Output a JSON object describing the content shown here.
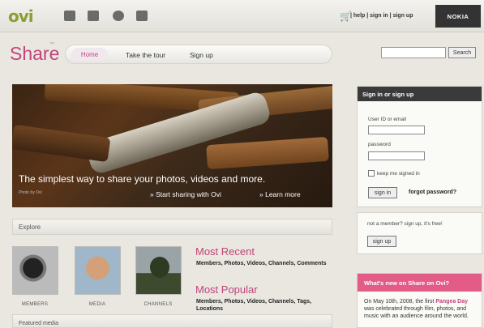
{
  "topbar": {
    "logo": "ovi",
    "icons": [
      "camera-icon",
      "music-icon",
      "globe-icon",
      "grid-icon"
    ],
    "links": [
      "help",
      "sign in",
      "sign up"
    ],
    "brand": "NOKIA"
  },
  "header": {
    "title": "Share",
    "nav": [
      "Home",
      "Take the tour",
      "Sign up"
    ],
    "search_placeholder": "",
    "search_label": "Search"
  },
  "hero": {
    "tagline": "The simplest way to share your photos, videos and more.",
    "credit": "Photo by Ovi",
    "cta_primary": "Start sharing with Ovi",
    "cta_secondary": "Learn more"
  },
  "explore": {
    "title": "Explore",
    "items": [
      {
        "label": "MEMBERS"
      },
      {
        "label": "MEDIA"
      },
      {
        "label": "CHANNELS"
      }
    ],
    "most_recent": {
      "title": "Most Recent",
      "links": "Members, Photos, Videos, Channels, Comments"
    },
    "most_popular": {
      "title": "Most Popular",
      "links": "Members, Photos, Videos, Channels, Tags, Locations"
    }
  },
  "featured": {
    "title": "Featured media"
  },
  "signin": {
    "header": "Sign in or sign up",
    "user_label": "User ID or email",
    "password_label": "password",
    "keep_label": "keep me signed in",
    "button": "sign in",
    "forgot": "forgot password?"
  },
  "member": {
    "text": "not a member? sign up, it's free!",
    "button": "sign up"
  },
  "news": {
    "header": "What's new on Share on Ovi?",
    "text_prefix": "On May 10th, 2008, the first ",
    "highlight": "Pangea Day",
    "text_suffix": " was celebrated through film, photos, and music with an audience around the world."
  },
  "colors": {
    "accent": "#c0457a",
    "nokia": "#333333",
    "news_header": "#e35b87"
  }
}
